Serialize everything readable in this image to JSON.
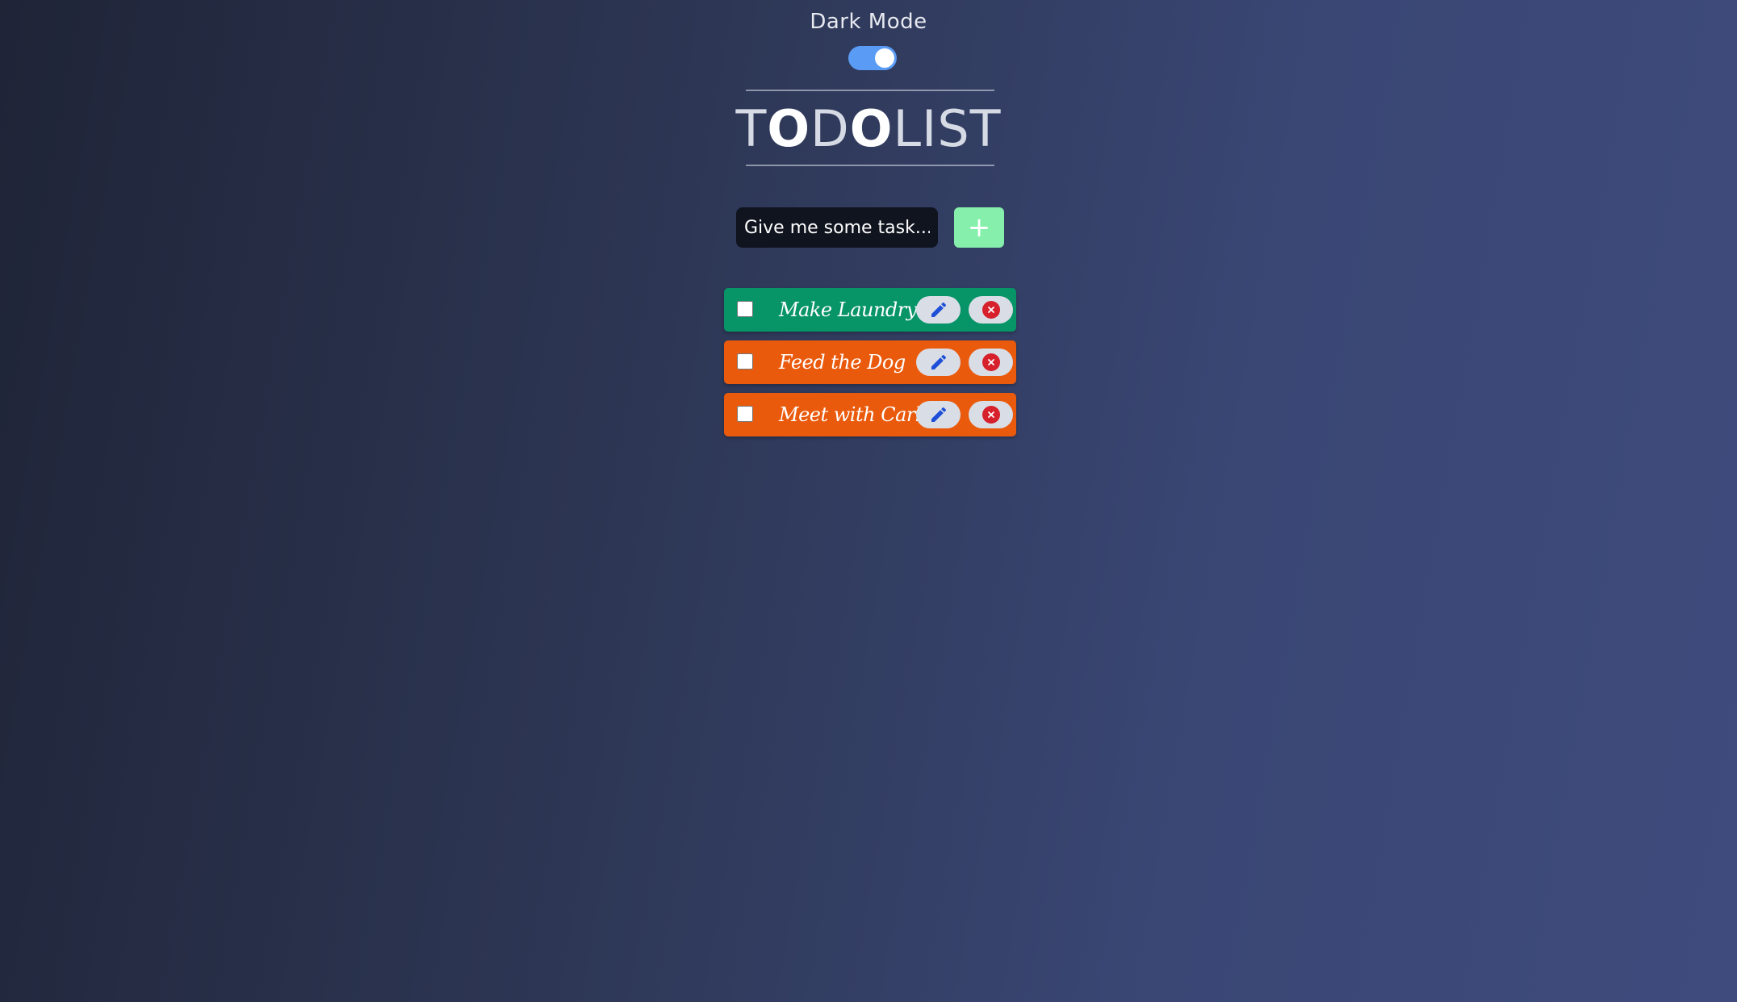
{
  "header": {
    "mode_label": "Dark Mode",
    "dark_mode_on": true
  },
  "title": {
    "letters": [
      "T",
      "O",
      "D",
      "O",
      "LIST"
    ],
    "full": "TODOLIST"
  },
  "form": {
    "placeholder": "Give me some task...",
    "value": "",
    "add_label": "+"
  },
  "colors": {
    "toggle_on": "#5a9cf5",
    "add_button": "#86efac",
    "input_bg": "#10141f",
    "completed": "#079466",
    "pending": "#ea5a0c",
    "edit_icon": "#1d4fd8",
    "delete_icon": "#d6202b"
  },
  "todos": [
    {
      "text": "Make Laundry",
      "checked": false,
      "color": "#079466",
      "edit_icon": "pencil-icon",
      "delete_icon": "close-circle-icon"
    },
    {
      "text": "Feed the Dog",
      "checked": false,
      "color": "#ea5a0c",
      "edit_icon": "pencil-icon",
      "delete_icon": "close-circle-icon"
    },
    {
      "text": "Meet with Carl",
      "checked": false,
      "color": "#ea5a0c",
      "edit_icon": "pencil-icon",
      "delete_icon": "close-circle-icon"
    }
  ]
}
